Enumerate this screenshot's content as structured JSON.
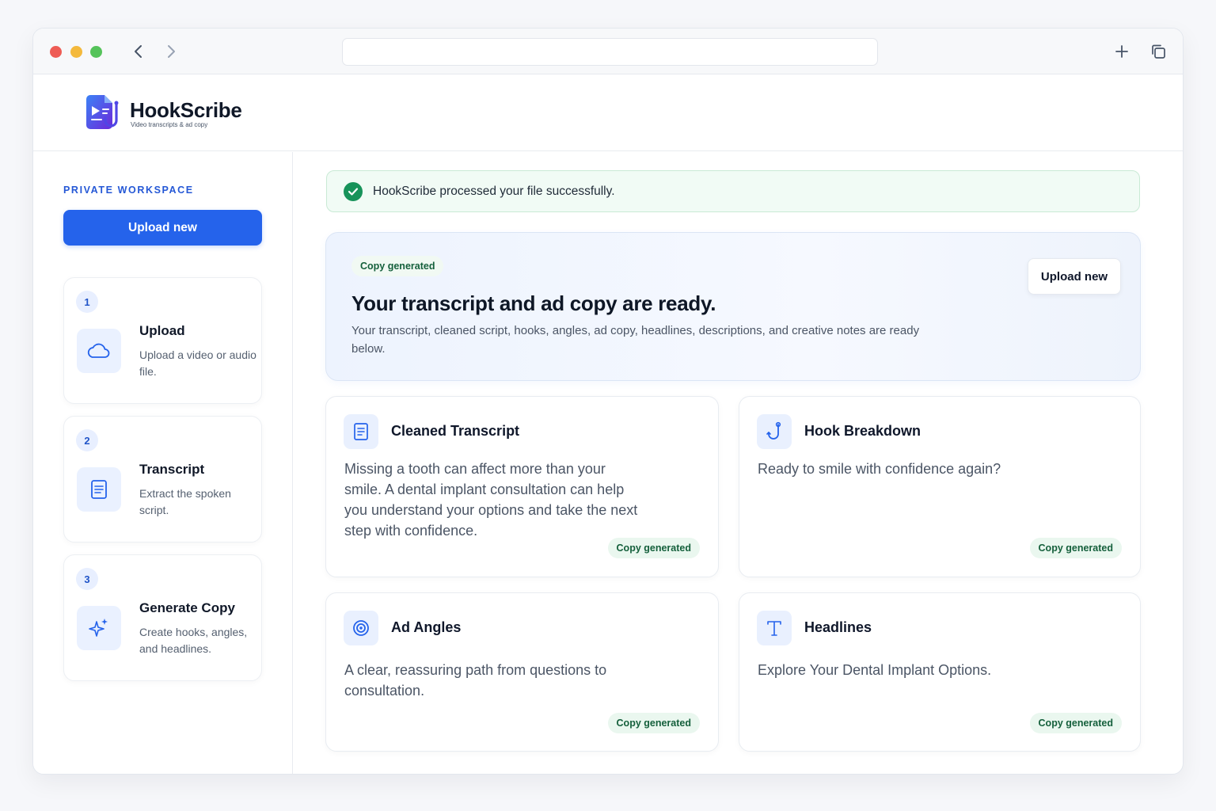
{
  "browser": {
    "back_icon": "chevron-left-icon",
    "forward_icon": "chevron-right-icon",
    "new_tab_icon": "plus-icon",
    "tabs_icon": "tabs-icon",
    "address": ""
  },
  "brand": {
    "name": "HookScribe",
    "tagline": "Video transcripts & ad copy",
    "accent": "#2563eb"
  },
  "sidebar": {
    "section_label": "PRIVATE WORKSPACE",
    "upload_button": "Upload new",
    "steps": [
      {
        "number": "1",
        "title": "Upload",
        "description": "Upload a video or audio file.",
        "icon": "cloud-icon"
      },
      {
        "number": "2",
        "title": "Transcript",
        "description": "Extract the spoken script.",
        "icon": "document-icon"
      },
      {
        "number": "3",
        "title": "Generate Copy",
        "description": "Create hooks, angles, and headlines.",
        "icon": "sparkle-icon"
      }
    ]
  },
  "banner": {
    "message": "HookScribe processed your file successfully.",
    "status_color": "#17935a"
  },
  "hero": {
    "badge": "Copy generated",
    "title": "Your transcript and ad copy are ready.",
    "subtitle": "Your transcript, cleaned script, hooks, angles, ad copy, headlines, descriptions, and creative notes are ready below.",
    "button": "Upload new"
  },
  "cards": [
    {
      "title": "Cleaned Transcript",
      "icon": "document-icon",
      "body": "Missing a tooth can affect more than your smile. A dental implant consultation can help you understand your options and take the next step with confidence.",
      "badge": "Copy generated"
    },
    {
      "title": "Hook Breakdown",
      "icon": "hook-icon",
      "body": "Ready to smile with confidence again?",
      "badge": "Copy generated"
    },
    {
      "title": "Ad Angles",
      "icon": "target-icon",
      "body": "A clear, reassuring path from questions to consultation.",
      "badge": "Copy generated"
    },
    {
      "title": "Headlines",
      "icon": "text-icon",
      "body": "Explore Your Dental Implant Options.",
      "badge": "Copy generated"
    }
  ]
}
